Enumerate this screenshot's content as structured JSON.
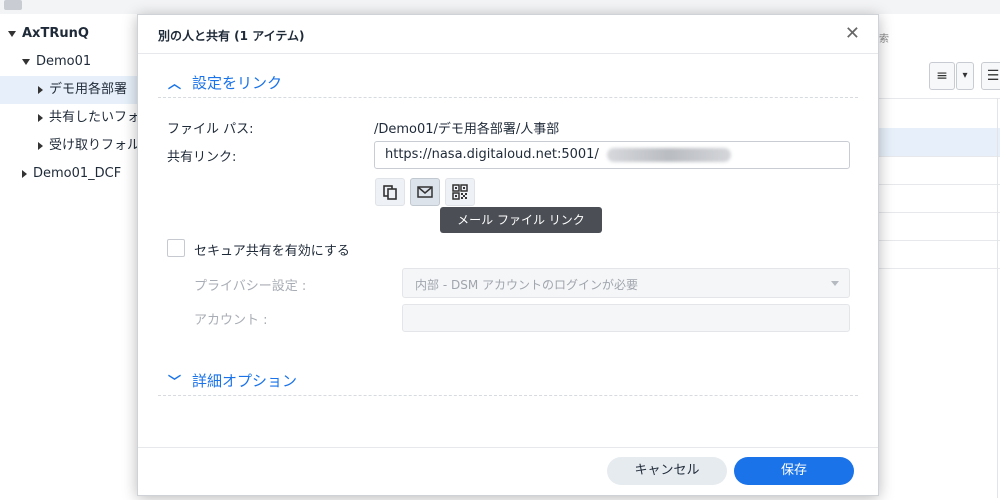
{
  "background": {
    "tree": [
      {
        "label": "AxTRunQ",
        "expanded": true
      },
      {
        "label": "Demo01",
        "expanded": true
      },
      {
        "label": "デモ用各部署",
        "expanded": false,
        "selected": true
      },
      {
        "label": "共有したいフォ",
        "expanded": false
      },
      {
        "label": "受け取りフォル",
        "expanded": false
      },
      {
        "label": "Demo01_DCF",
        "expanded": false
      }
    ],
    "right_hint": "索",
    "list_view_icon": "≡",
    "dropdown_icon": "▾",
    "sort_icon": "☰"
  },
  "dialog": {
    "title": "別の人と共有 (1 アイテム)",
    "close_icon": "✕",
    "link_section": {
      "chevron": "︿",
      "title": "設定をリンク",
      "file_path_label": "ファイル パス:",
      "file_path_value": "/Demo01/デモ用各部署/人事部",
      "share_link_label": "共有リンク:",
      "share_link_value": "https://nasa.digitaloud.net:5001/",
      "actions": [
        {
          "name": "copy-icon"
        },
        {
          "name": "mail-icon",
          "active": true
        },
        {
          "name": "qr-code-icon"
        }
      ],
      "tooltip": "メール ファイル リンク"
    },
    "secure_share": {
      "checkbox_label": "セキュア共有を有効にする",
      "checked": false,
      "privacy_label": "プライバシー設定 :",
      "privacy_value": "内部 - DSM アカウントのログインが必要",
      "account_label": "アカウント :",
      "account_value": ""
    },
    "advanced_section": {
      "chevron": "﹀",
      "title": "詳細オプション"
    },
    "footer": {
      "cancel_label": "キャンセル",
      "save_label": "保存"
    }
  },
  "colors": {
    "accent": "#1a73e8",
    "selected_row": "#e7f0fa",
    "tooltip_bg": "#4b4f55"
  }
}
